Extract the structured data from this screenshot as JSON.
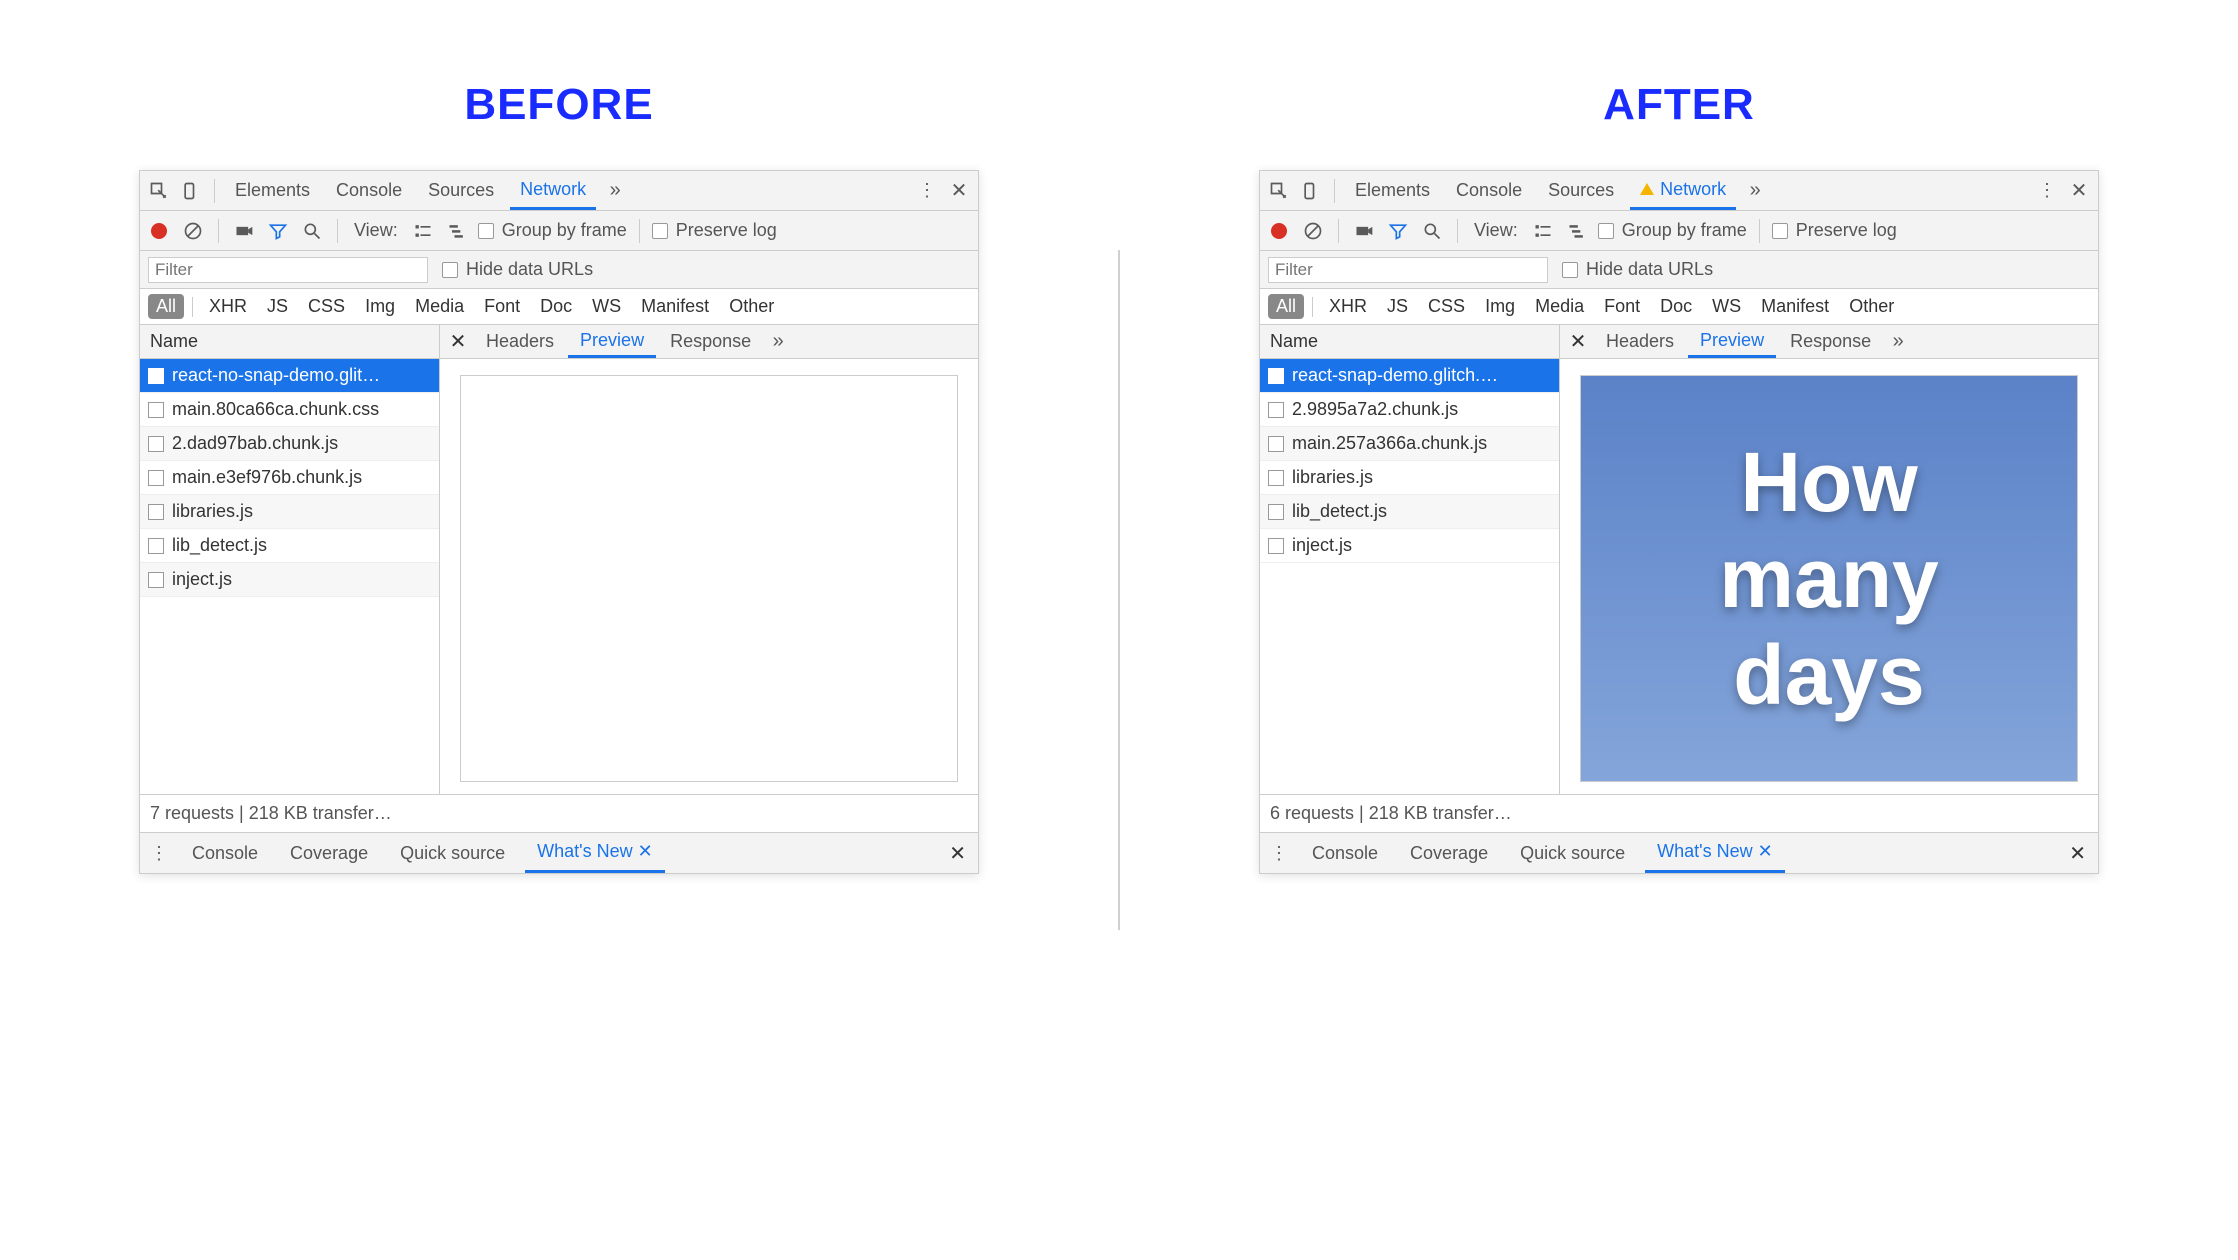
{
  "headings": {
    "before": "BEFORE",
    "after": "AFTER"
  },
  "topTabs": {
    "elements": "Elements",
    "console": "Console",
    "sources": "Sources",
    "network": "Network"
  },
  "toolbar": {
    "viewLabel": "View:",
    "groupByFrame": "Group by frame",
    "preserveLog": "Preserve log"
  },
  "filterRow": {
    "placeholder": "Filter",
    "hideData": "Hide data URLs"
  },
  "typeChips": {
    "all": "All",
    "xhr": "XHR",
    "js": "JS",
    "css": "CSS",
    "img": "Img",
    "media": "Media",
    "font": "Font",
    "doc": "Doc",
    "ws": "WS",
    "manifest": "Manifest",
    "other": "Other"
  },
  "nameHeader": "Name",
  "detailTabs": {
    "headers": "Headers",
    "preview": "Preview",
    "response": "Response"
  },
  "before": {
    "requests": [
      "react-no-snap-demo.glit…",
      "main.80ca66ca.chunk.css",
      "2.dad97bab.chunk.js",
      "main.e3ef976b.chunk.js",
      "libraries.js",
      "lib_detect.js",
      "inject.js"
    ],
    "summary": "7 requests | 218 KB transfer…"
  },
  "after": {
    "requests": [
      "react-snap-demo.glitch.…",
      "2.9895a7a2.chunk.js",
      "main.257a366a.chunk.js",
      "libraries.js",
      "lib_detect.js",
      "inject.js"
    ],
    "summary": "6 requests | 218 KB transfer…",
    "previewWords": {
      "w1": "How",
      "w2": "many",
      "w3": "days"
    }
  },
  "drawer": {
    "console": "Console",
    "coverage": "Coverage",
    "quickSource": "Quick source",
    "whatsNew": "What's New"
  }
}
